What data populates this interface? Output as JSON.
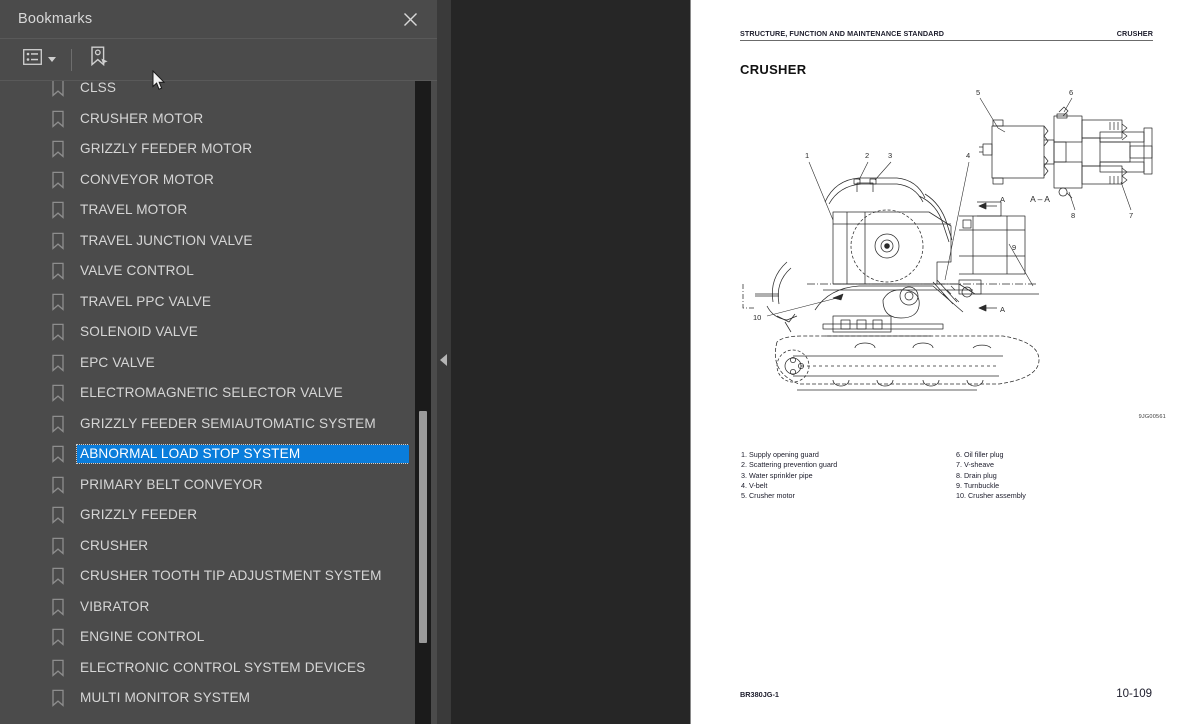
{
  "panel": {
    "title": "Bookmarks",
    "close_icon": "close-icon",
    "toolbar": {
      "options_icon": "list-options-icon",
      "options_caret_icon": "chevron-down-icon",
      "new_bookmark_icon": "new-bookmark-icon"
    },
    "collapse_icon": "collapse-left-arrow-icon",
    "selected_index": 12,
    "items": [
      {
        "label": "CLSS"
      },
      {
        "label": "CRUSHER MOTOR"
      },
      {
        "label": "GRIZZLY FEEDER MOTOR"
      },
      {
        "label": "CONVEYOR MOTOR"
      },
      {
        "label": "TRAVEL MOTOR"
      },
      {
        "label": "TRAVEL JUNCTION VALVE"
      },
      {
        "label": "VALVE CONTROL"
      },
      {
        "label": "TRAVEL PPC VALVE"
      },
      {
        "label": "SOLENOID VALVE"
      },
      {
        "label": "EPC VALVE"
      },
      {
        "label": "ELECTROMAGNETIC SELECTOR VALVE"
      },
      {
        "label": "GRIZZLY FEEDER SEMIAUTOMATIC SYSTEM"
      },
      {
        "label": "ABNORMAL LOAD STOP SYSTEM"
      },
      {
        "label": "PRIMARY BELT CONVEYOR"
      },
      {
        "label": "GRIZZLY FEEDER"
      },
      {
        "label": "CRUSHER"
      },
      {
        "label": "CRUSHER TOOTH TIP ADJUSTMENT SYSTEM"
      },
      {
        "label": "VIBRATOR"
      },
      {
        "label": "ENGINE CONTROL"
      },
      {
        "label": "ELECTRONIC CONTROL SYSTEM DEVICES"
      },
      {
        "label": "MULTI MONITOR SYSTEM"
      }
    ]
  },
  "document": {
    "header_left": "STRUCTURE, FUNCTION AND MAINTENANCE STANDARD",
    "header_right": "CRUSHER",
    "heading": "CRUSHER",
    "drawing_code": "9JG00561",
    "section_label": "A – A",
    "callouts": [
      "1",
      "2",
      "3",
      "4",
      "5",
      "6",
      "7",
      "8",
      "9",
      "10",
      "A",
      "A"
    ],
    "legend_left": [
      "1. Supply opening guard",
      "2. Scattering prevention guard",
      "3. Water sprinkler pipe",
      "4. V-belt",
      "5. Crusher motor"
    ],
    "legend_right": [
      "6. Oil filler plug",
      "7. V-sheave",
      "8. Drain plug",
      "9. Turnbuckle",
      "10. Crusher assembly"
    ],
    "footer_left": "BR380JG-1",
    "footer_right": "10-109"
  },
  "colors": {
    "panel_bg": "#4b4b4b",
    "selection": "#0a7ddb",
    "viewer_bg": "#262626",
    "page_bg": "#ffffff"
  }
}
